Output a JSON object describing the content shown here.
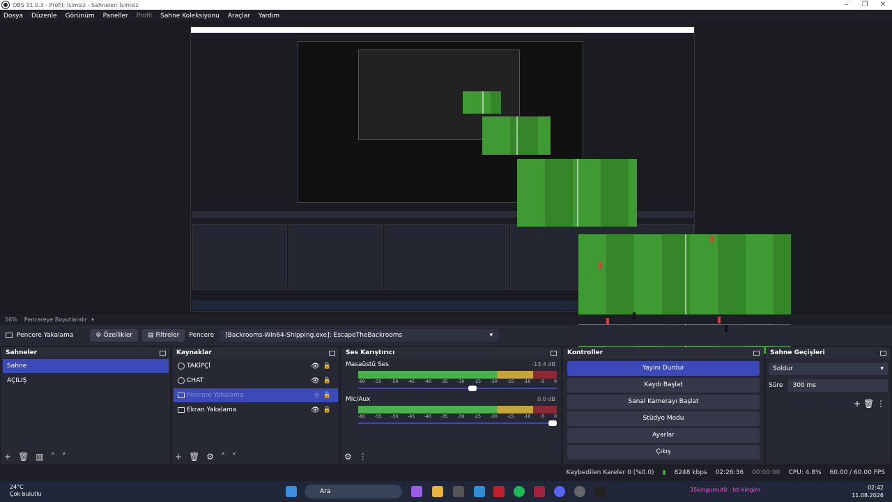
{
  "window": {
    "title": "OBS 31.0.3 - Profil: İsimsiz - Sahneler: İsimsiz"
  },
  "menu": [
    {
      "label": "Dosya",
      "enabled": true
    },
    {
      "label": "Düzenle",
      "enabled": true
    },
    {
      "label": "Görünüm",
      "enabled": true
    },
    {
      "label": "Paneller",
      "enabled": true
    },
    {
      "label": "Profil",
      "enabled": false
    },
    {
      "label": "Sahne Koleksiyonu",
      "enabled": true
    },
    {
      "label": "Araçlar",
      "enabled": true
    },
    {
      "label": "Yardım",
      "enabled": true
    }
  ],
  "preview_status": {
    "zoom": "56%",
    "fit": "Pencereye Boyutlandır"
  },
  "source_toolbar": {
    "source_name": "Pencere Yakalama",
    "properties": "Özellikler",
    "filters": "Filtreler",
    "window_label": "Pencere",
    "window_value": "[Backrooms-Win64-Shipping.exe]: EscapeTheBackrooms"
  },
  "scenes": {
    "title": "Sahneler",
    "items": [
      "Sahne",
      "AÇILIŞ"
    ],
    "selected": 0
  },
  "sources": {
    "title": "Kaynaklar",
    "items": [
      {
        "name": "TAKİPÇİ",
        "icon": "globe-icon"
      },
      {
        "name": "CHAT",
        "icon": "globe-icon"
      },
      {
        "name": "Pencere Yakalama",
        "icon": "window-icon"
      },
      {
        "name": "Ekran Yakalama",
        "icon": "monitor-icon"
      }
    ],
    "selected": 2
  },
  "mixer": {
    "title": "Ses Karıştırıcı",
    "channels": [
      {
        "name": "Masaüstü Ses",
        "db": "-13.4 dB",
        "volume": 0.58
      },
      {
        "name": "Mic/Aux",
        "db": "0.0 dB",
        "volume": 1.0
      }
    ],
    "ticks": [
      "-60",
      "-55",
      "-50",
      "-45",
      "-40",
      "-35",
      "-30",
      "-25",
      "-20",
      "-15",
      "-10",
      "-5",
      "0"
    ]
  },
  "controls": {
    "title": "Kontroller",
    "buttons": [
      "Yayını Durdur",
      "Kaydı Başlat",
      "Sanal Kamerayı Başlat",
      "Stüdyo Modu",
      "Ayarlar",
      "Çıkış"
    ]
  },
  "transitions": {
    "title": "Sahne Geçişleri",
    "type": "Soldur",
    "duration_label": "Süre",
    "duration": "300 ms"
  },
  "status": {
    "dropped": "Kaybedilen Kareler 0 (%0.0)",
    "bitrate": "8248 kbps",
    "stream_time": "02:26:36",
    "rec_time": "00:00:00",
    "cpu": "CPU: 4.8%",
    "fps": "60.00 / 60.00 FPS"
  },
  "taskbar": {
    "temp": "24°C",
    "weather": "Çok bulutlu",
    "search": "Ara",
    "notif": "35kingumut0 : bb kingim",
    "time": "02:42",
    "date": "11.08.2026"
  }
}
